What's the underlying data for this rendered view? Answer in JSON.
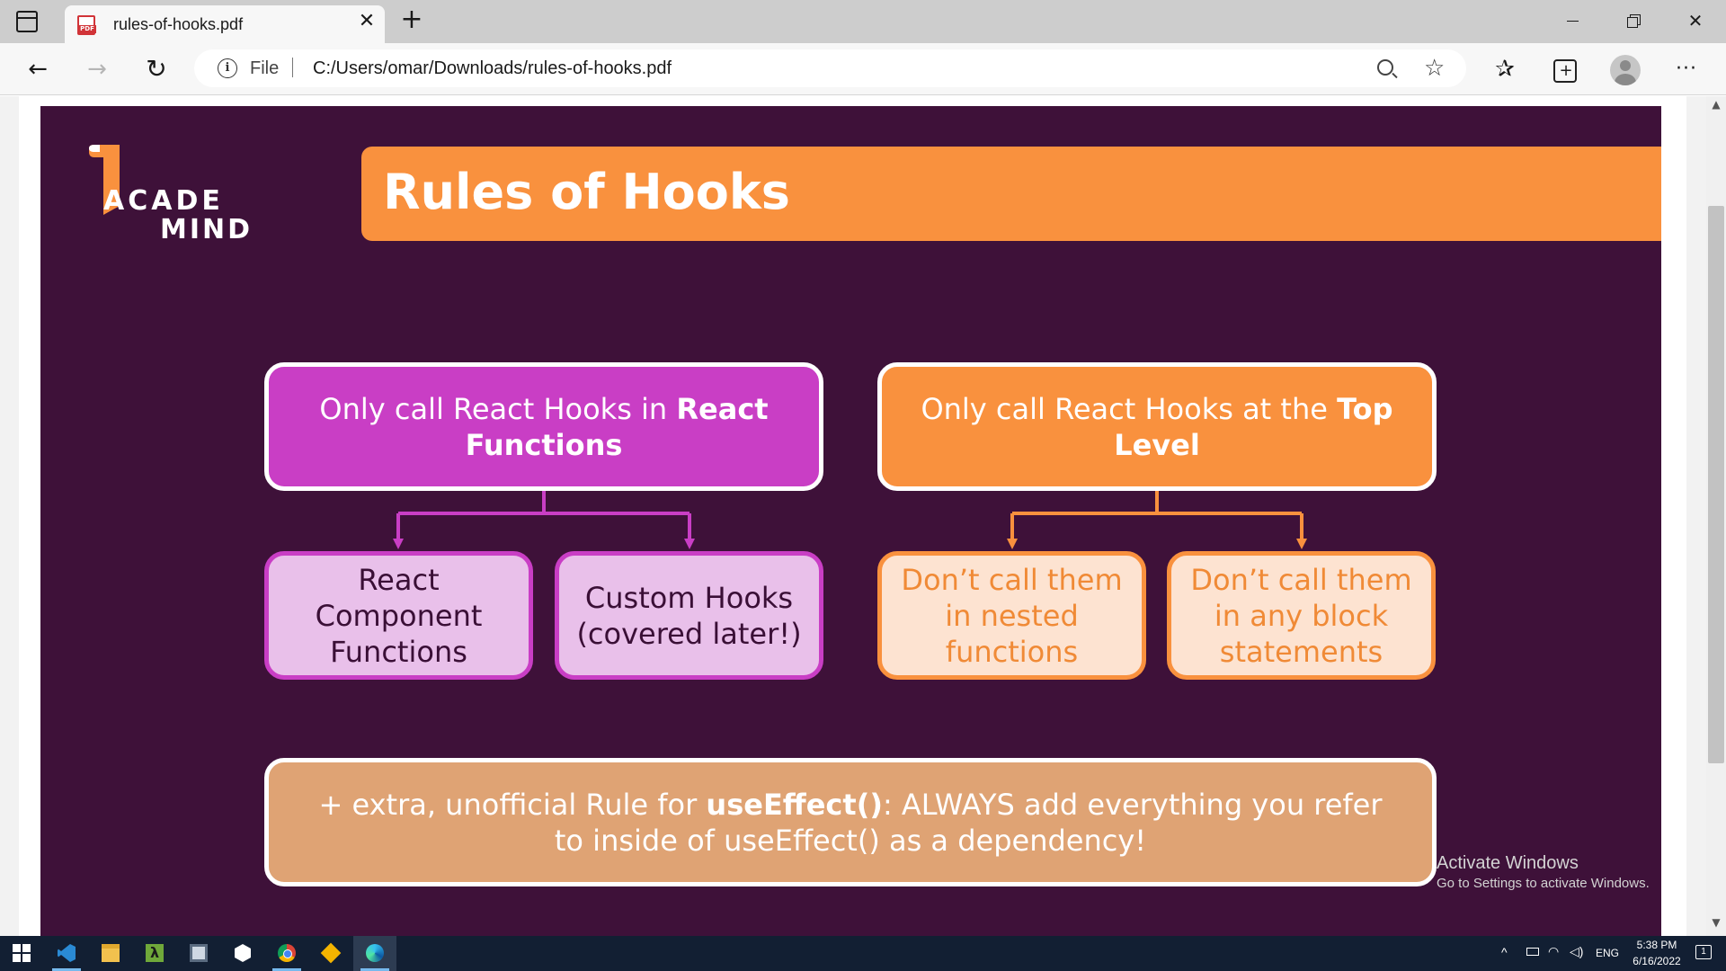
{
  "browser": {
    "tab_title": "rules-of-hooks.pdf",
    "tab_close": "✕",
    "new_tab": "+",
    "file_label": "File",
    "url": "C:/Users/omar/Downloads/rules-of-hooks.pdf",
    "nav": {
      "back": "←",
      "forward": "→",
      "refresh": "↻"
    },
    "icons": {
      "favorites": "✰",
      "favorite_add": "☆",
      "more": "···"
    },
    "window": {
      "close": "✕"
    }
  },
  "slide": {
    "logo": {
      "line1": "ACADE",
      "line2": "MIND",
      "accent_color": "#f9913e"
    },
    "title": "Rules of Hooks",
    "rule1": {
      "text_regular": "Only call React Hooks in ",
      "text_bold": "React Functions",
      "subitems": [
        "React Component Functions",
        "Custom Hooks (covered later!)"
      ],
      "color": "#c93ec5"
    },
    "rule2": {
      "text_regular": "Only call React Hooks at the ",
      "text_bold": "Top Level",
      "subitems": [
        "Don’t call them in nested functions",
        "Don’t call them in any block statements"
      ],
      "color": "#f9913e"
    },
    "extra_rule": {
      "prefix": "+ extra, unofficial Rule for ",
      "bold": "useEffect()",
      "suffix": ": ALWAYS add everything you refer to inside of useEffect() as a dependency!"
    },
    "background": "#3e1139"
  },
  "watermark": {
    "title": "Activate Windows",
    "subtitle": "Go to Settings to activate Windows."
  },
  "taskbar": {
    "apps": [
      "start-icon",
      "vscode-icon",
      "file-explorer-icon",
      "lambda-app-icon",
      "terminal-icon",
      "hexagon-app-icon",
      "chrome-icon",
      "git-icon",
      "edge-icon"
    ],
    "tray": {
      "chevron": "^",
      "language": "ENG",
      "time": "5:38 PM",
      "date": "6/16/2022",
      "notifications": "1"
    }
  }
}
